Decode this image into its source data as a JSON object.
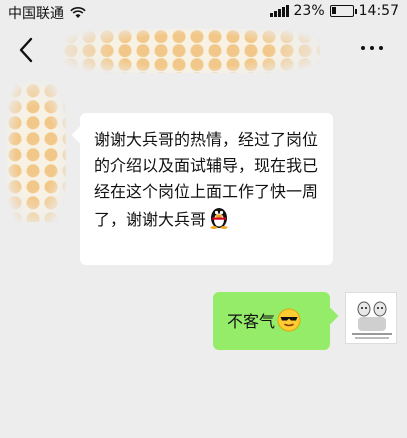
{
  "status_bar": {
    "carrier": "中国联通",
    "battery_percent": "23%",
    "battery_level": 0.23,
    "time": "14:57",
    "wifi_icon": "wifi-icon",
    "signal_icon": "signal-icon"
  },
  "nav": {
    "back_icon": "chevron-left-icon",
    "more_icon": "more-dots-icon"
  },
  "messages": [
    {
      "side": "left",
      "text": "谢谢大兵哥的热情，经过了岗位的介绍以及面试辅导，现在我已经在这个岗位上面工作了快一周了，谢谢大兵哥",
      "trailing_icon": "qq-penguin-icon"
    },
    {
      "side": "right",
      "text": "不客气",
      "trailing_icon": "sunglasses-emoji-icon"
    }
  ],
  "colors": {
    "background": "#ededed",
    "incoming_bubble": "#ffffff",
    "outgoing_bubble": "#95ec69"
  }
}
